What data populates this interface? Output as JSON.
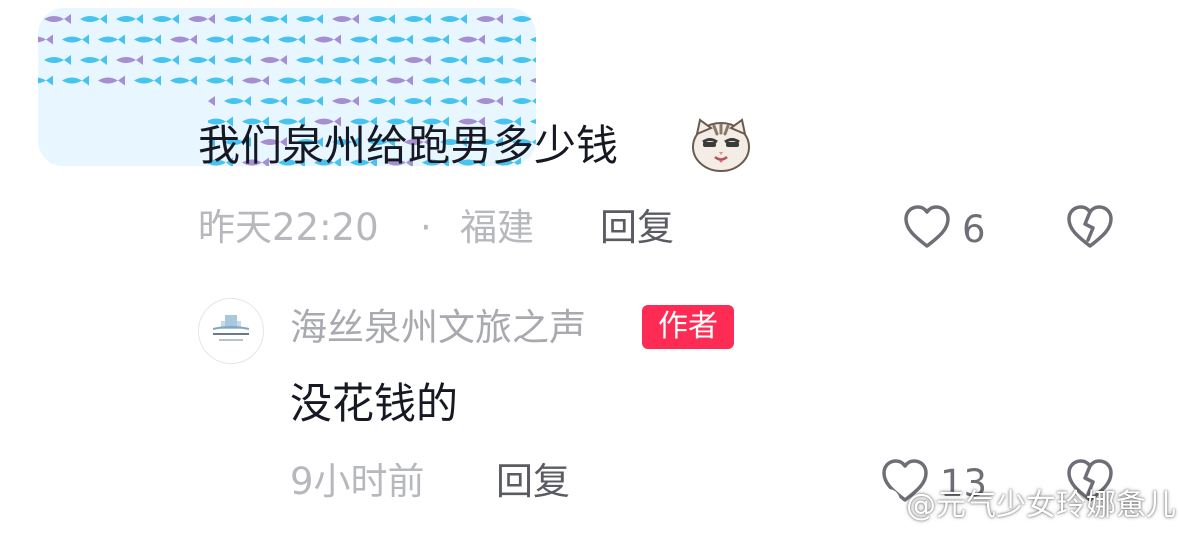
{
  "comment": {
    "text": "我们泉州给跑男多少钱",
    "emoji": "cat-smirk-emoji",
    "time": "昨天22:20",
    "separator": "·",
    "location": "福建",
    "reply_label": "回复",
    "like_count": "6"
  },
  "reply": {
    "author": "海丝泉州文旅之声",
    "badge": "作者",
    "text": "没花钱的",
    "time": "9小时前",
    "reply_label": "回复",
    "like_count": "13"
  },
  "watermark": {
    "text": "@元气少女玲娜惫儿"
  },
  "colors": {
    "text_primary": "#161823",
    "text_meta": "#b7b8bd",
    "badge_bg": "#fe2c55",
    "mosaic_blue": "#46c3ef",
    "mosaic_purple": "#a58fd0"
  }
}
